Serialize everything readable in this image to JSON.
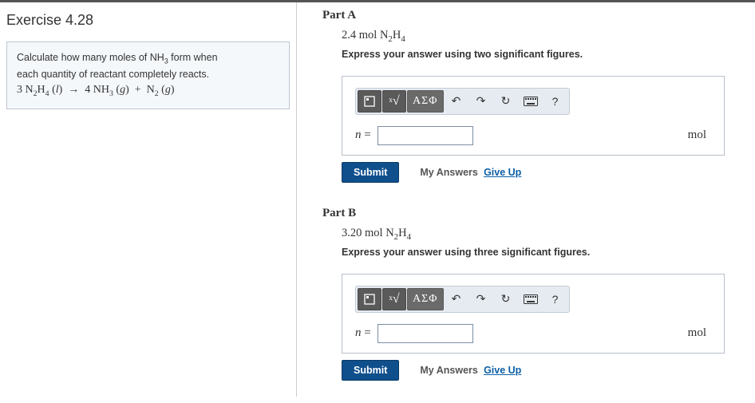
{
  "exercise": {
    "title": "Exercise 4.28",
    "prompt_prefix": "Calculate how many moles of ",
    "prompt_suffix": " form when",
    "prompt_line2": "each quantity of reactant completely reacts.",
    "reaction_text": "3 N2H4 (l) → 4 NH3 (g) + N2 (g)"
  },
  "toolbar": {
    "greek": "ΑΣΦ",
    "help": "?"
  },
  "partA": {
    "heading": "Part A",
    "given_value": "2.4",
    "given_unit": "mol",
    "given_species": "N2H4",
    "instruction": "Express your answer using two significant figures.",
    "var": "n",
    "value": "",
    "unit": "mol"
  },
  "partB": {
    "heading": "Part B",
    "given_value": "3.20",
    "given_unit": "mol",
    "given_species": "N2H4",
    "instruction": "Express your answer using three significant figures.",
    "var": "n",
    "value": "",
    "unit": "mol"
  },
  "actions": {
    "submit": "Submit",
    "my_answers": "My Answers",
    "give_up": "Give Up"
  }
}
